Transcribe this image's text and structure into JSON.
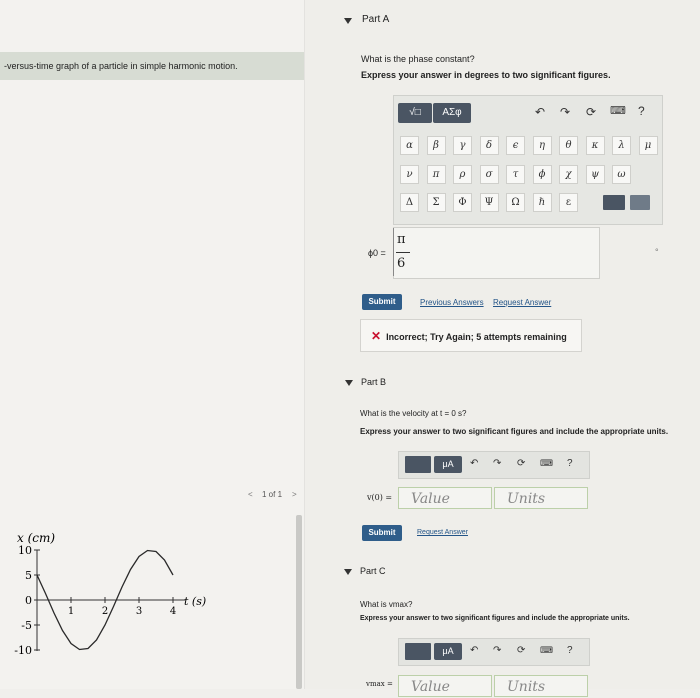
{
  "left_panel": {
    "caption": "-versus-time graph of a particle in simple harmonic motion.",
    "pager": {
      "prev": "<",
      "label": "1 of 1",
      "next": ">"
    },
    "chart_labels": {
      "ylabel": "x (cm)",
      "xlabel": "t (s)"
    }
  },
  "chart_data": {
    "type": "line",
    "title": "",
    "xlabel": "t (s)",
    "ylabel": "x (cm)",
    "xlim": [
      0,
      4.5
    ],
    "ylim": [
      -10,
      10
    ],
    "xticks": [
      "1",
      "2",
      "3",
      "4"
    ],
    "yticks": [
      "10",
      "5",
      "0",
      "-5",
      "-10"
    ],
    "series": [
      {
        "x": [
          0,
          0.25,
          0.5,
          0.75,
          1.0,
          1.25,
          1.5,
          1.75,
          2.0,
          2.25,
          2.5,
          2.75,
          3.0,
          3.25,
          3.5,
          3.75,
          4.0
        ],
        "values": [
          5.0,
          1.3,
          -2.6,
          -6.1,
          -8.7,
          -9.9,
          -9.7,
          -8.0,
          -5.0,
          -1.3,
          2.6,
          6.1,
          8.7,
          9.9,
          9.7,
          8.0,
          5.0
        ]
      }
    ]
  },
  "part_a": {
    "header": "Part A",
    "question": "What is the phase constant?",
    "instruction": "Express your answer in degrees to two significant figures.",
    "toolbar": {
      "templates": "√□",
      "greek": "AΣφ",
      "help": "?"
    },
    "greek_rows": [
      [
        "α",
        "β",
        "γ",
        "δ",
        "ϵ",
        "η",
        "θ",
        "κ",
        "λ",
        "μ"
      ],
      [
        "ν",
        "π",
        "ρ",
        "σ",
        "τ",
        "ϕ",
        "χ",
        "ψ",
        "ω"
      ],
      [
        "Δ",
        "Σ",
        "Φ",
        "Ψ",
        "Ω",
        "ℏ",
        "ε"
      ]
    ],
    "answer_label": "ϕ0 =",
    "answer_numerator": "π",
    "answer_denominator": "6",
    "answer_unit": "°",
    "submit": "Submit",
    "previous_answers": "Previous Answers",
    "request_answer": "Request Answer",
    "feedback": "Incorrect; Try Again; 5 attempts remaining",
    "feedback_icon": "✕"
  },
  "part_b": {
    "header": "Part B",
    "question": "What is the velocity at t = 0 s?",
    "instruction": "Express your answer to two significant figures and include the appropriate units.",
    "toolbar": {
      "units": "μA",
      "help": "?"
    },
    "answer_label": "v(0) =",
    "value_placeholder": "Value",
    "units_placeholder": "Units",
    "submit": "Submit",
    "request_answer": "Request Answer"
  },
  "part_c": {
    "header": "Part C",
    "question": "What is vmax?",
    "instruction": "Express your answer to two significant figures and include the appropriate units.",
    "toolbar": {
      "units": "μA",
      "help": "?"
    },
    "answer_label": "vmax =",
    "value_placeholder": "Value",
    "units_placeholder": "Units"
  }
}
